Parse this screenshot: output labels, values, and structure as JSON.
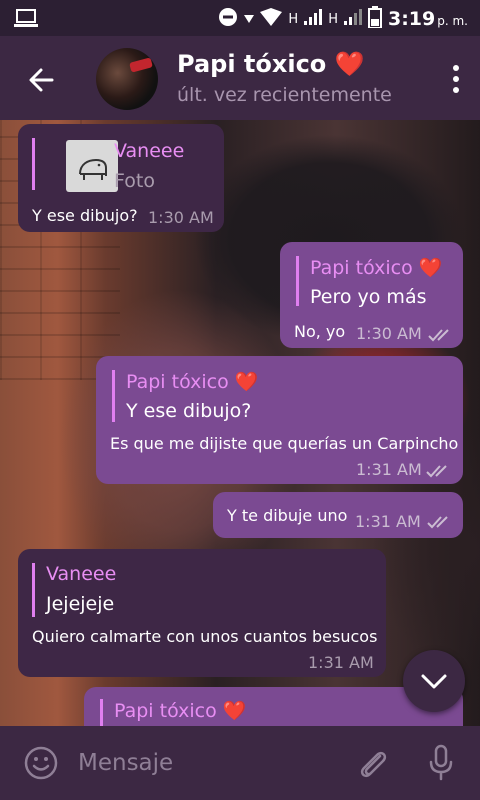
{
  "status_bar": {
    "network_a": "H",
    "network_b": "H",
    "time": "3:19",
    "ampm": "p. m."
  },
  "header": {
    "title": "Papi tóxico",
    "title_emoji": "❤️",
    "subtitle": "últ. vez recientemente"
  },
  "messages": [
    {
      "direction": "in",
      "quote_name": "Vaneee",
      "quote_text": "Foto",
      "text": "Y ese dibujo?",
      "time": "1:30 AM"
    },
    {
      "direction": "out",
      "quote_name": "Papi tóxico",
      "quote_text": "Pero yo más",
      "text": "No, yo",
      "time": "1:30 AM",
      "read": true
    },
    {
      "direction": "out",
      "quote_name": "Papi tóxico",
      "quote_text": "Y ese dibujo?",
      "text": "Es que me dijiste que querías un Carpincho",
      "time": "1:31 AM",
      "read": true
    },
    {
      "direction": "out",
      "text": "Y te dibuje uno",
      "time": "1:31 AM",
      "read": true
    },
    {
      "direction": "in",
      "quote_name": "Vaneee",
      "quote_text": "Jejejeje",
      "text": "Quiero calmarte con unos cuantos besucos",
      "time": "1:31 AM"
    },
    {
      "direction": "out",
      "quote_name": "Papi tóxico"
    }
  ],
  "composer": {
    "placeholder": "Mensaje"
  },
  "colors": {
    "header_bg": "#3c2843",
    "incoming_bubble": "#3e2746",
    "outgoing_bubble": "#7b4a92",
    "quote_accent": "#e88ef3"
  },
  "icons": {
    "back": "arrow-left-icon",
    "menu": "more-vertical-icon",
    "scroll_down": "chevron-down-icon",
    "emoji": "smiley-icon",
    "attach": "paperclip-icon",
    "mic": "microphone-icon"
  }
}
